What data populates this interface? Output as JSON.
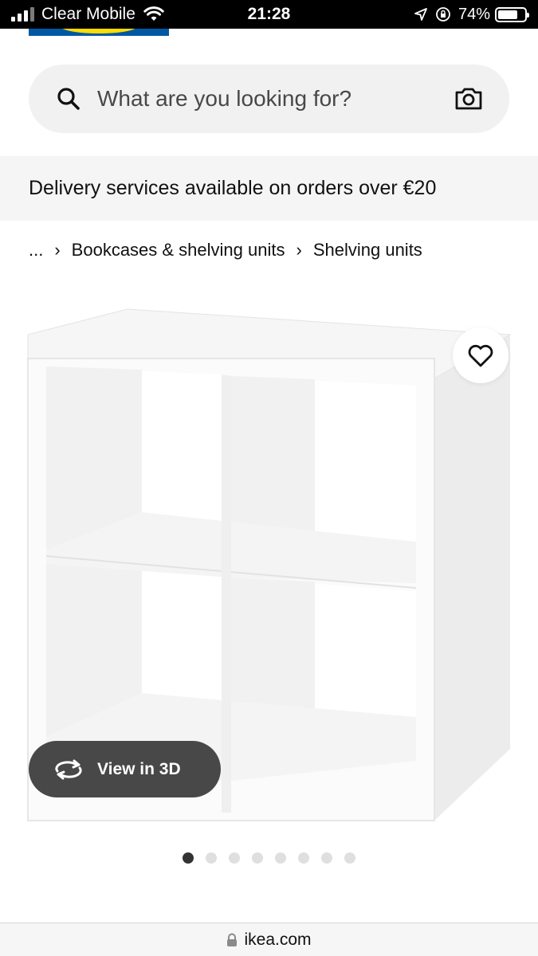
{
  "status_bar": {
    "carrier": "Clear Mobile",
    "time": "21:28",
    "battery_percent": "74%",
    "battery_level": 0.74,
    "icons": [
      "signal-icon",
      "wifi-icon",
      "location-arrow-icon",
      "orientation-lock-icon",
      "battery-icon"
    ]
  },
  "search": {
    "placeholder": "What are you looking for?",
    "value": "",
    "icons": [
      "search-icon",
      "camera-icon"
    ]
  },
  "banner": {
    "text": "Delivery services available on orders over €20"
  },
  "breadcrumb": {
    "items": [
      "...",
      "Bookcases & shelving units",
      "Shelving units"
    ],
    "separator": "›"
  },
  "product": {
    "image_icon": "shelving-unit-image",
    "favourite_icon": "heart-icon",
    "view_3d_label": "View in 3D",
    "view_3d_icon": "rotate-3d-icon"
  },
  "carousel": {
    "total": 8,
    "active_index": 0
  },
  "url_bar": {
    "domain": "ikea.com",
    "icon": "lock-icon"
  },
  "colors": {
    "brand_blue": "#0058a3",
    "brand_yellow": "#ffdb00",
    "search_bg": "#f1f1f1",
    "banner_bg": "#f5f5f5",
    "view3d_bg": "#484848",
    "dot_active": "#333333",
    "dot_inactive": "#dfdfdf"
  }
}
